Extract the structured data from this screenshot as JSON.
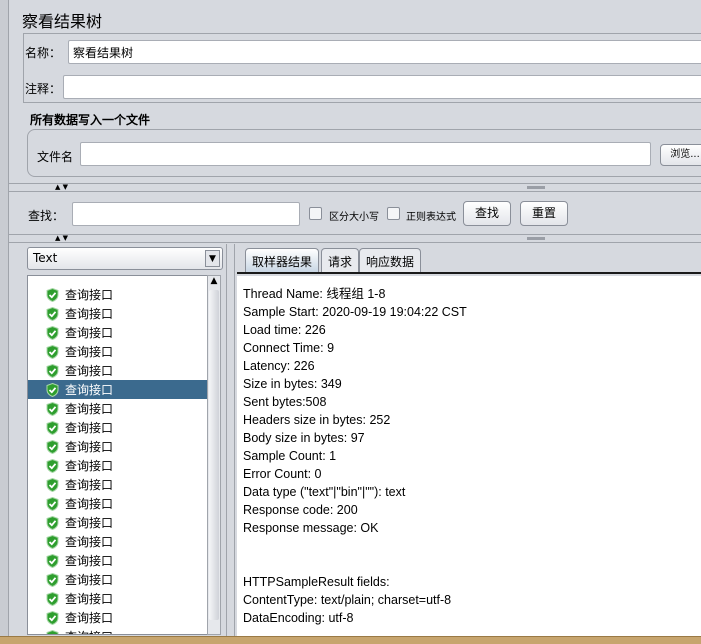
{
  "title": "察看结果树",
  "name_label": "名称：",
  "name_value": "察看结果树",
  "comment_label": "注释：",
  "comment_value": "",
  "file_section": {
    "title": "所有数据写入一个文件",
    "file_label": "文件名",
    "file_value": "",
    "browse": "浏览..."
  },
  "search": {
    "label": "查找：",
    "value": "",
    "case_sensitive": "区分大小写",
    "regex": "正则表达式",
    "find": "查找",
    "reset": "重置"
  },
  "renderer": "Text",
  "tree": {
    "items": [
      "查询接口",
      "查询接口",
      "查询接口",
      "查询接口",
      "查询接口",
      "查询接口",
      "查询接口",
      "查询接口",
      "查询接口",
      "查询接口",
      "查询接口",
      "查询接口",
      "查询接口",
      "查询接口",
      "查询接口",
      "查询接口",
      "查询接口",
      "查询接口",
      "查询接口"
    ],
    "selected_index": 5,
    "status_icon": "green-shield-check",
    "status_color": "#2e9e2e",
    "selected_color": "#3b6a8e"
  },
  "tabs": [
    "取样器结果",
    "请求",
    "响应数据"
  ],
  "active_tab": 0,
  "result_lines": [
    "Thread Name: 线程组 1-8",
    "Sample Start: 2020-09-19 19:04:22 CST",
    "Load time: 226",
    "Connect Time: 9",
    "Latency: 226",
    "Size in bytes: 349",
    "Sent bytes:508",
    "Headers size in bytes: 252",
    "Body size in bytes: 97",
    "Sample Count: 1",
    "Error Count: 0",
    "Data type (\"text\"|\"bin\"|\"\"): text",
    "Response code: 200",
    "Response message: OK",
    "",
    "",
    "HTTPSampleResult fields:",
    "ContentType: text/plain; charset=utf-8",
    "DataEncoding: utf-8"
  ]
}
